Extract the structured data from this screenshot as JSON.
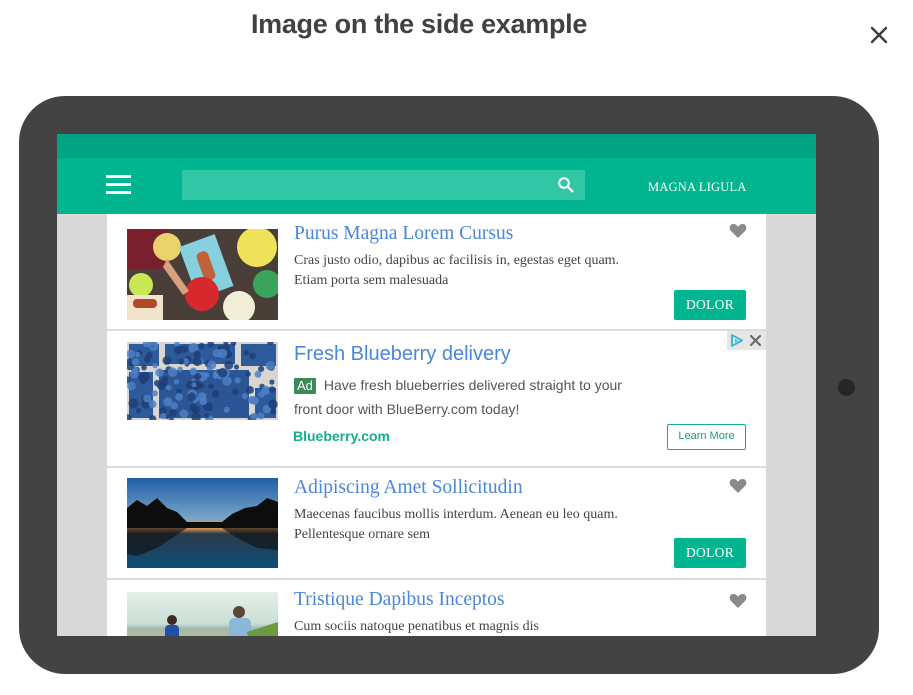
{
  "dialog": {
    "title": "Image on the side example",
    "close_icon": "close-icon"
  },
  "app": {
    "brand": "MAGNA LIGULA",
    "menu_icon": "hamburger-menu-icon",
    "search": {
      "value": "",
      "placeholder": "",
      "icon": "search-icon"
    },
    "colors": {
      "status_bar": "#00a383",
      "app_bar": "#00b58f",
      "search_box": "#33c6a6",
      "title_link": "#4a86d9",
      "button": "#00b58f",
      "device_frame": "#434343"
    }
  },
  "feed": {
    "items": [
      {
        "type": "article",
        "title": "Purus Magna Lorem Cursus",
        "description": "Cras justo odio, dapibus ac facilisis in, egestas eget quam. Etiam porta sem malesuada",
        "image": "picnic-food-photo",
        "button_label": "DOLOR",
        "favorite_icon": "heart-icon"
      },
      {
        "type": "ad",
        "title": "Fresh Blueberry delivery",
        "badge": "Ad",
        "description": "Have fresh blueberries delivered straight to your front door with BlueBerry.com today!",
        "domain": "Blueberry.com",
        "image": "blueberries-photo",
        "button_label": "Learn More",
        "adchoices_icon": "adchoices-icon",
        "close_icon": "close-ad-icon"
      },
      {
        "type": "article",
        "title": "Adipiscing Amet Sollicitudin",
        "description": "Maecenas faucibus mollis interdum. Aenean eu leo quam. Pellentesque ornare sem",
        "image": "palm-sunset-photo",
        "button_label": "DOLOR",
        "favorite_icon": "heart-icon"
      },
      {
        "type": "article",
        "title": "Tristique Dapibus Inceptos",
        "description": "Cum sociis natoque penatibus et magnis dis",
        "image": "family-beach-photo",
        "favorite_icon": "heart-icon"
      }
    ]
  }
}
